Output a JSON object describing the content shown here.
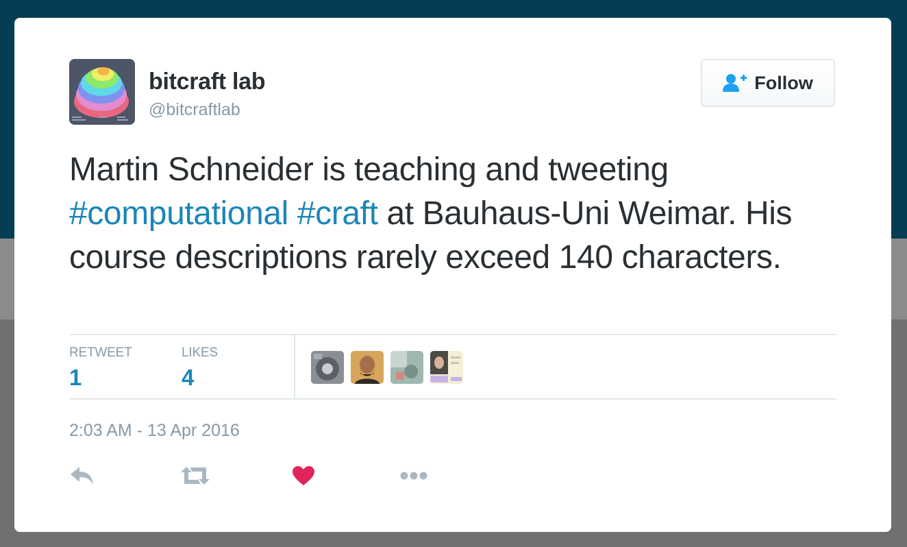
{
  "user": {
    "display_name": "bitcraft lab",
    "screen_name": "@bitcraftlab",
    "avatar_icon": "layered-blob-avatar"
  },
  "follow_button": {
    "label": "Follow",
    "icon": "add-user-icon"
  },
  "tweet": {
    "segments": [
      {
        "text": "Martin Schneider is teaching and tweeting ",
        "type": "text"
      },
      {
        "text": "#computational",
        "type": "hashtag"
      },
      {
        "text": " ",
        "type": "text"
      },
      {
        "text": "#craft",
        "type": "hashtag"
      },
      {
        "text": " at Bauhaus-Uni Weimar. His course descriptions rarely exceed 140 characters.",
        "type": "text"
      }
    ]
  },
  "stats": {
    "retweets": {
      "label": "RETWEET",
      "value": "1"
    },
    "likes": {
      "label": "LIKES",
      "value": "4"
    }
  },
  "likers": [
    "liker-avatar-1",
    "liker-avatar-2",
    "liker-avatar-3",
    "liker-avatar-4"
  ],
  "timestamp": "2:03 AM - 13 Apr 2016",
  "actions": {
    "reply": "reply-icon",
    "retweet": "retweet-icon",
    "like": "heart-icon",
    "more": "more-dots-icon"
  },
  "colors": {
    "link": "#1b86b7",
    "like": "#e0245e",
    "muted": "#8899a6",
    "text": "#292f33",
    "top_background": "#053d54"
  }
}
